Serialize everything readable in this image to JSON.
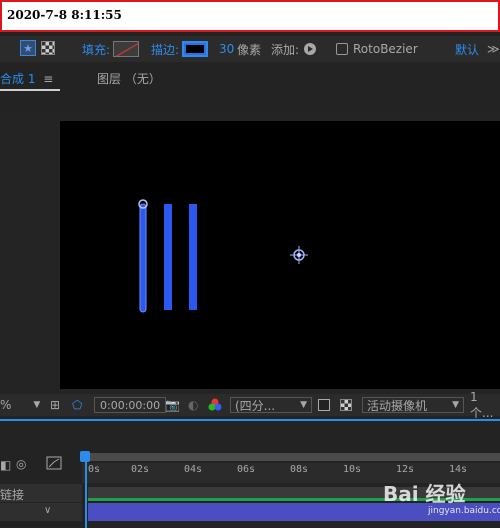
{
  "timestamp": "2020-7-8 8:11:55",
  "toolbar": {
    "fill_label": "填充:",
    "stroke_label": "描边:",
    "stroke_width": "30",
    "px_unit": "像素",
    "add_label": "添加:",
    "rotobezier": "RotoBezier",
    "default_label": "默认",
    "menu_glyph": "≫"
  },
  "tabs": {
    "comp_tab": "合成 1",
    "comp_menu": "≡",
    "layer_tab": "图层 （无）"
  },
  "viewer_controls": {
    "zoom_suffix": "%",
    "timecode": "0:00:00:00",
    "resolution": "(四分...",
    "camera": "活动摄像机",
    "views": "1 个..."
  },
  "timeline": {
    "ticks": [
      "0s",
      "02s",
      "04s",
      "06s",
      "08s",
      "10s",
      "12s",
      "14s"
    ],
    "link_label": "链接"
  },
  "watermark": {
    "brand": "Bai 经验",
    "site": "jingyan.baidu.com"
  },
  "colors": {
    "accent": "#2d8ceb",
    "shape_blue": "#2b59f0",
    "stamp_border": "#e0141b"
  }
}
